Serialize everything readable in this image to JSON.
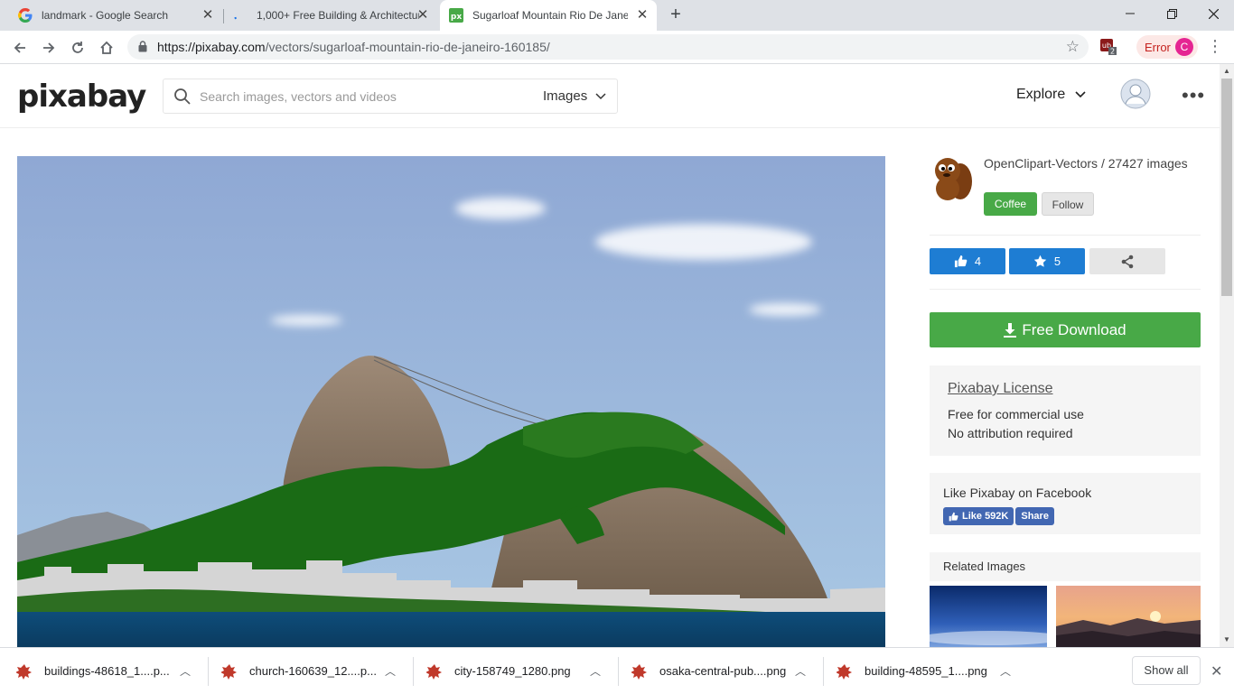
{
  "browser": {
    "tabs": [
      {
        "title": "landmark - Google Search",
        "icon": "google-icon"
      },
      {
        "title": "1,000+ Free Building & Architecture",
        "icon": "loading-icon"
      },
      {
        "title": "Sugarloaf Mountain Rio De Janeiro",
        "icon": "pixabay-favicon"
      }
    ],
    "new_tab_label": "+",
    "url_host": "https://pixabay.com",
    "url_path": "/vectors/sugarloaf-mountain-rio-de-janeiro-160185/",
    "extension_badge": "2",
    "error_label": "Error",
    "profile_initial": "C"
  },
  "site": {
    "logo": "pixabay",
    "search_placeholder": "Search images, vectors and videos",
    "search_type": "Images",
    "explore_label": "Explore"
  },
  "author": {
    "name_line": "OpenClipart-Vectors / 27427 images",
    "coffee_label": "Coffee",
    "follow_label": "Follow"
  },
  "stats": {
    "likes": "4",
    "favorites": "5"
  },
  "download_label": "Free Download",
  "license": {
    "title": "Pixabay License",
    "line1": "Free for commercial use",
    "line2": "No attribution required"
  },
  "facebook": {
    "title": "Like Pixabay on Facebook",
    "like_label": "Like 592K",
    "share_label": "Share"
  },
  "related_title": "Related Images",
  "downloads": {
    "items": [
      {
        "name": "buildings-48618_1....p..."
      },
      {
        "name": "church-160639_12....p..."
      },
      {
        "name": "city-158749_1280.png"
      },
      {
        "name": "osaka-central-pub....png"
      },
      {
        "name": "building-48595_1....png"
      }
    ],
    "show_all_label": "Show all"
  },
  "colors": {
    "brand_green": "#48a947",
    "like_blue": "#1e7dd3",
    "facebook_blue": "#4267b2"
  }
}
